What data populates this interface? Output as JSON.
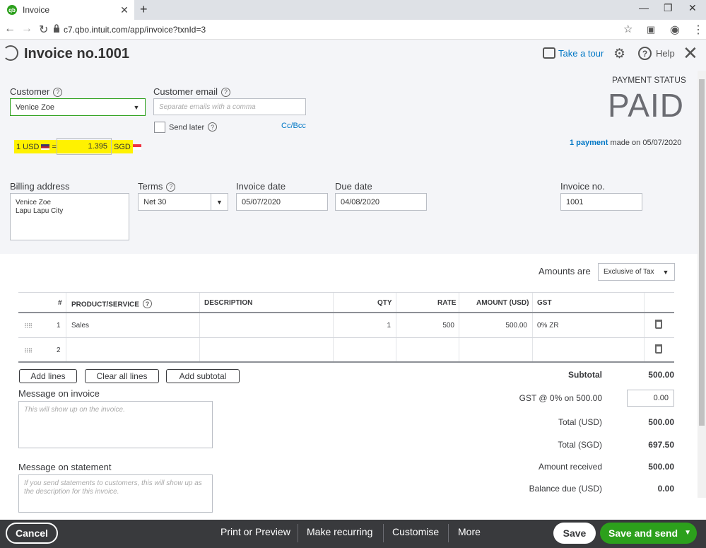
{
  "browser": {
    "tab_title": "Invoice",
    "tab_favicon": "qb",
    "url": "c7.qbo.intuit.com/app/invoice?txnId=3"
  },
  "header": {
    "title": "Invoice no.1001",
    "take_tour": "Take a tour",
    "help": "Help"
  },
  "customer": {
    "label": "Customer",
    "value": "Venice Zoe",
    "email_label": "Customer email",
    "email_placeholder": "Separate emails with a comma",
    "send_later": "Send later",
    "cc_bcc": "Cc/Bcc"
  },
  "exchange": {
    "from": "1 USD",
    "equals": "=",
    "rate": "1.395",
    "to": "SGD"
  },
  "payment": {
    "status_label": "PAYMENT STATUS",
    "status": "PAID",
    "link": "1 payment",
    "rest": " made on 05/07/2020"
  },
  "billing": {
    "label": "Billing address",
    "line1": "Venice Zoe",
    "line2": "Lapu Lapu City"
  },
  "terms": {
    "label": "Terms",
    "value": "Net 30"
  },
  "invoice_date": {
    "label": "Invoice date",
    "value": "05/07/2020"
  },
  "due_date": {
    "label": "Due date",
    "value": "04/08/2020"
  },
  "invoice_no": {
    "label": "Invoice no.",
    "value": "1001"
  },
  "amounts_are": {
    "label": "Amounts are",
    "value": "Exclusive of Tax"
  },
  "table": {
    "headers": [
      "#",
      "PRODUCT/SERVICE",
      "DESCRIPTION",
      "QTY",
      "RATE",
      "AMOUNT (USD)",
      "GST"
    ],
    "rows": [
      {
        "num": "1",
        "product": "Sales",
        "description": "",
        "qty": "1",
        "rate": "500",
        "amount": "500.00",
        "gst": "0% ZR"
      },
      {
        "num": "2",
        "product": "",
        "description": "",
        "qty": "",
        "rate": "",
        "amount": "",
        "gst": ""
      }
    ]
  },
  "actions": {
    "add_lines": "Add lines",
    "clear_all": "Clear all lines",
    "add_subtotal": "Add subtotal"
  },
  "messages": {
    "invoice_label": "Message on invoice",
    "invoice_placeholder": "This will show up on the invoice.",
    "statement_label": "Message on statement",
    "statement_placeholder": "If you send statements to customers, this will show up as the description for this invoice."
  },
  "totals": {
    "subtotal_label": "Subtotal",
    "subtotal": "500.00",
    "gst_label": "GST @ 0% on 500.00",
    "gst": "0.00",
    "total_usd_label": "Total (USD)",
    "total_usd": "500.00",
    "total_sgd_label": "Total (SGD)",
    "total_sgd": "697.50",
    "received_label": "Amount received",
    "received": "500.00",
    "balance_label": "Balance due (USD)",
    "balance": "0.00"
  },
  "footer": {
    "cancel": "Cancel",
    "print": "Print or Preview",
    "recurring": "Make recurring",
    "customise": "Customise",
    "more": "More",
    "save": "Save",
    "save_send": "Save and send"
  }
}
